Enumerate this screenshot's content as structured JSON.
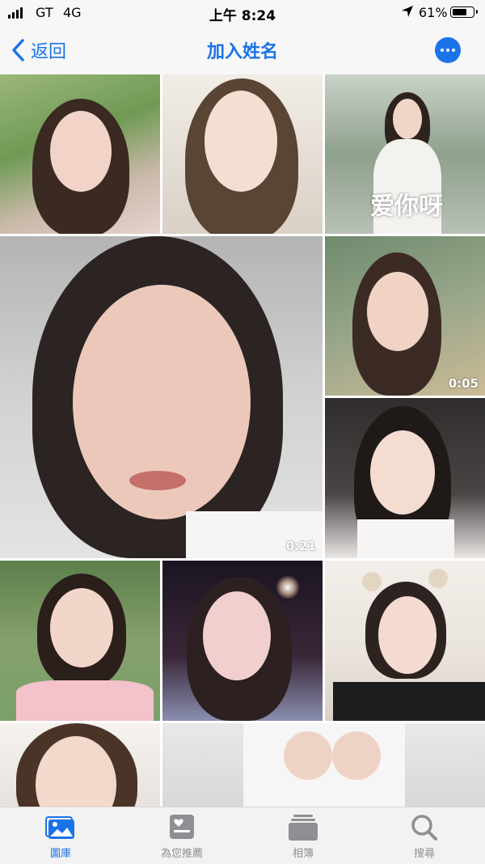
{
  "status": {
    "carrier": "GT",
    "network": "4G",
    "time": "上午 8:24",
    "battery": "61%"
  },
  "nav": {
    "back_label": "返回",
    "title": "加入姓名"
  },
  "grid": {
    "tiles": [
      {
        "kind": "photo"
      },
      {
        "kind": "photo"
      },
      {
        "kind": "photo",
        "caption": "爱你呀"
      },
      {
        "kind": "video",
        "duration": "0:21"
      },
      {
        "kind": "video",
        "duration": "0:05"
      },
      {
        "kind": "photo"
      },
      {
        "kind": "photo"
      },
      {
        "kind": "photo"
      },
      {
        "kind": "photo"
      },
      {
        "kind": "photo"
      },
      {
        "kind": "photo"
      }
    ]
  },
  "tabbar": {
    "items": [
      {
        "label": "圖庫",
        "icon": "photo-library-icon",
        "active": true
      },
      {
        "label": "為您推薦",
        "icon": "for-you-icon",
        "active": false
      },
      {
        "label": "相簿",
        "icon": "albums-icon",
        "active": false
      },
      {
        "label": "搜尋",
        "icon": "search-icon",
        "active": false
      }
    ]
  },
  "colors": {
    "accent": "#1a73e8",
    "inactive": "#8e8e93"
  }
}
